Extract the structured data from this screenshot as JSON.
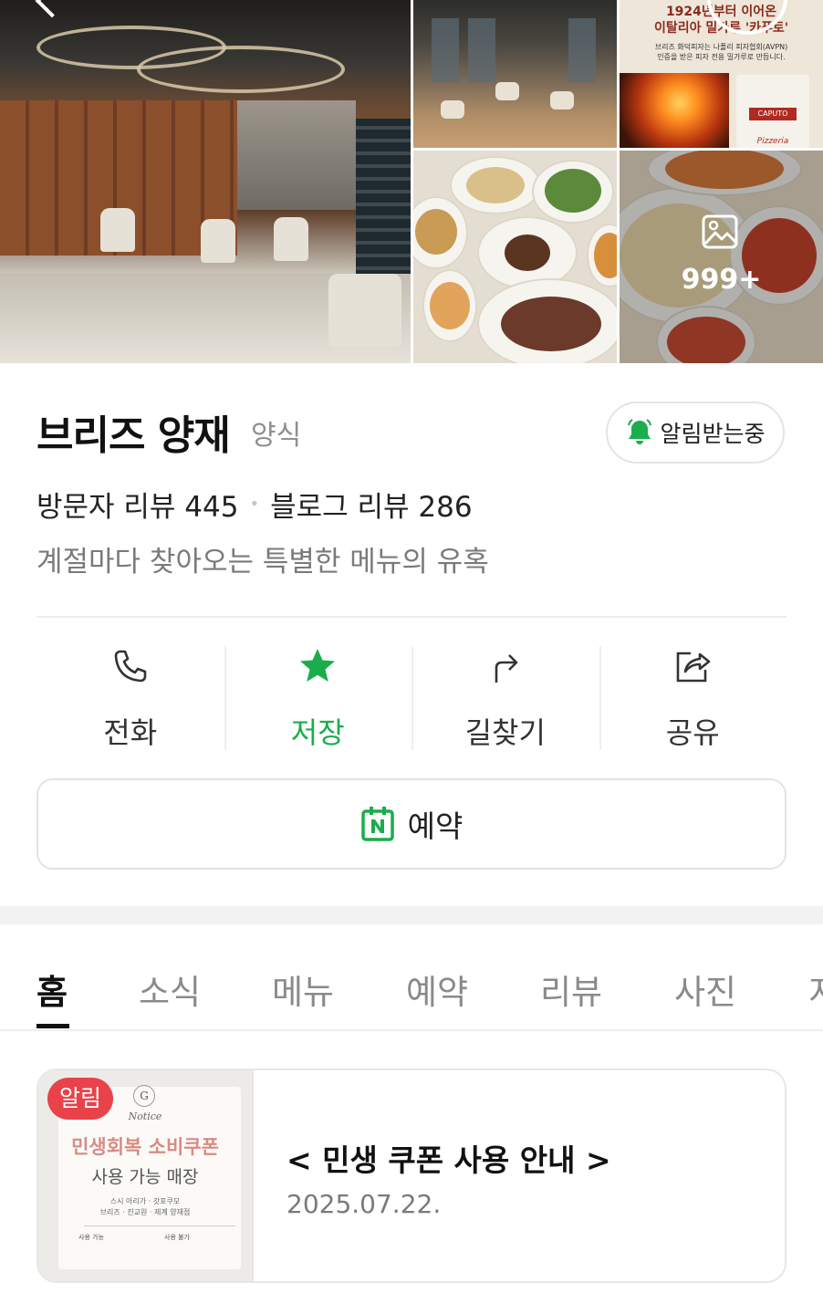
{
  "gallery": {
    "ad_headline": "1924년부터 이어온\n이탈리아 밀가루 '카푸토'",
    "ad_subtext": "브리즈 화덕피자는 나폴리 피자협회(AVPN)\n인증을 받은 피자 전용 밀가루로 만듭니다.",
    "ad_bag_label": "CAPUTO",
    "ad_bag_text": "Pizzeria",
    "photo_count": "999+"
  },
  "place": {
    "name": "브리즈 양재",
    "category": "양식",
    "notify_label": "알림받는중",
    "visitor_reviews": "방문자 리뷰 445",
    "separator": "•",
    "blog_reviews": "블로그 리뷰 286",
    "description": "계절마다 찾아오는 특별한 메뉴의 유혹"
  },
  "actions": [
    {
      "label": "전화",
      "icon": "phone-icon"
    },
    {
      "label": "저장",
      "icon": "star-icon",
      "active": true
    },
    {
      "label": "길찾기",
      "icon": "directions-icon"
    },
    {
      "label": "공유",
      "icon": "share-icon"
    }
  ],
  "reserve": {
    "label": "예약",
    "icon": "naver-booking-icon"
  },
  "tabs": [
    "홈",
    "소식",
    "메뉴",
    "예약",
    "리뷰",
    "사진",
    "지"
  ],
  "active_tab": "홈",
  "notice": {
    "badge": "알림",
    "thumb_notice": "Notice",
    "thumb_title": "민생회복 소비쿠폰",
    "thumb_subtitle": "사용 가능 매장",
    "thumb_stores": "스시 아리가 · 갓포쿠모\n브리즈 · 진교원 · 제계 양재점",
    "thumb_ok": "사용 가능",
    "thumb_no": "사용 불가",
    "title": "< 민생 쿠폰 사용 안내 >",
    "date": "2025.07.22."
  },
  "colors": {
    "accent_green": "#1aad4c",
    "badge_red": "#e8424b"
  }
}
